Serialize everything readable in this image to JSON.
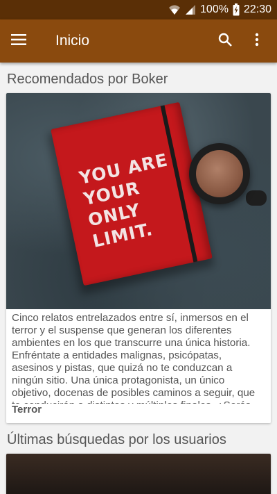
{
  "status_bar": {
    "battery": "100%",
    "time": "22:30",
    "icons": [
      "wifi-icon",
      "signal-icon",
      "battery-charging-icon"
    ]
  },
  "app_bar": {
    "title": "Inicio",
    "icons": [
      "menu-icon",
      "search-icon",
      "more-vert-icon"
    ],
    "color": "#8a4a0e"
  },
  "sections": {
    "recommended": {
      "title": "Recomendados por Boker",
      "book": {
        "cover_text": "YOU ARE YOUR ONLY LIMIT.",
        "description": "Cinco relatos entrelazados entre sí, inmersos en el terror y el suspense que generan los diferentes ambientes en los que transcurre una única historia. Enfréntate a entidades malignas, psicópatas, asesinos y pistas, que quizá no te conduzcan a ningún sitio. Una única protagonista, un único objetivo, docenas de posibles caminos a seguir, que te conducirán a distintos y múltiples finales. ¿Serás capaz de llegar a todos ellos y descubrir qué te",
        "genre": "Terror"
      }
    },
    "latest_searches": {
      "title": "Últimas búsquedas por los usuarios"
    }
  }
}
